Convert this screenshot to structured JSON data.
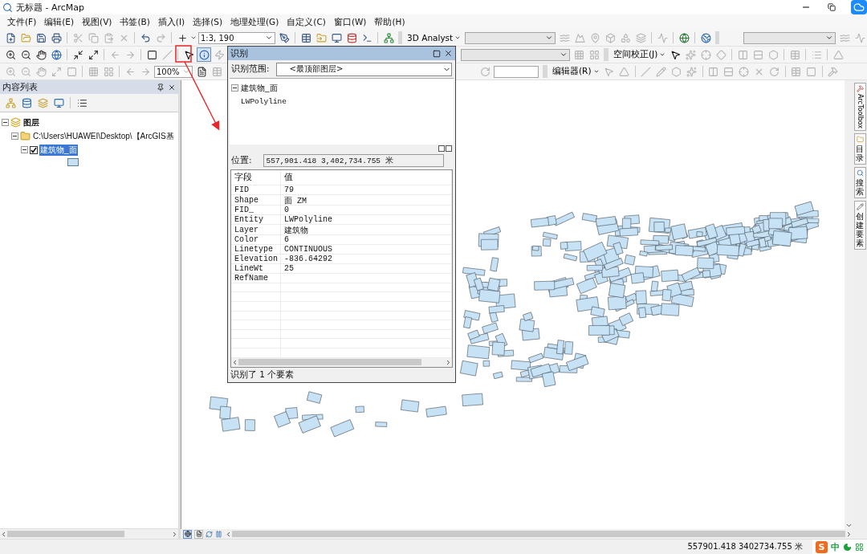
{
  "window": {
    "title": "无标题 - ArcMap"
  },
  "menu": [
    "文件(F)",
    "编辑(E)",
    "视图(V)",
    "书签(B)",
    "插入(I)",
    "选择(S)",
    "地理处理(G)",
    "自定义(C)",
    "窗口(W)",
    "帮助(H)"
  ],
  "toolbars": {
    "scale": "1:3, 190",
    "analyst": "3D Analyst",
    "zoom": "100%",
    "spatial_adjustment": "空间校正(J)",
    "editor": "编辑器(R)"
  },
  "toc": {
    "title": "内容列表",
    "tree": [
      {
        "label": "图层",
        "expanded": true,
        "children": [
          {
            "label": "C:\\Users\\HUAWEI\\Desktop\\【ArcGIS基",
            "expanded": true,
            "children": [
              {
                "label": "建筑物_面",
                "checked": true,
                "selected": true,
                "expanded": true
              }
            ]
          }
        ]
      }
    ]
  },
  "identify": {
    "title": "识别",
    "scope_label": "识别范围:",
    "scope": "<最顶部图层>",
    "tree": [
      {
        "label": "建筑物_面",
        "expanded": true,
        "children": [
          {
            "label": "LWPolyline"
          }
        ]
      }
    ],
    "location_label": "位置:",
    "location": "557,901.418   3,402,734.755 米",
    "columns": [
      "字段",
      "值"
    ],
    "rows": [
      {
        "field": "FID",
        "value": "79"
      },
      {
        "field": "Shape",
        "value": "面 ZM"
      },
      {
        "field": "FID_",
        "value": "0"
      },
      {
        "field": "Entity",
        "value": "LWPolyline"
      },
      {
        "field": "Layer",
        "value": "建筑物"
      },
      {
        "field": "Color",
        "value": "6"
      },
      {
        "field": "Linetype",
        "value": "CONTINUOUS"
      },
      {
        "field": "Elevation",
        "value": "-836.64292"
      },
      {
        "field": "LineWt",
        "value": "25"
      },
      {
        "field": "RefName"
      }
    ],
    "status": "识别了 1 个要素"
  },
  "right_tabs": [
    "ArcToolbox",
    "目录",
    "搜索",
    "创建要素"
  ],
  "status_bar": {
    "coordinates": "557901.418  3402734.755 米"
  },
  "tray": {
    "logo": "S",
    "ime": "中"
  }
}
